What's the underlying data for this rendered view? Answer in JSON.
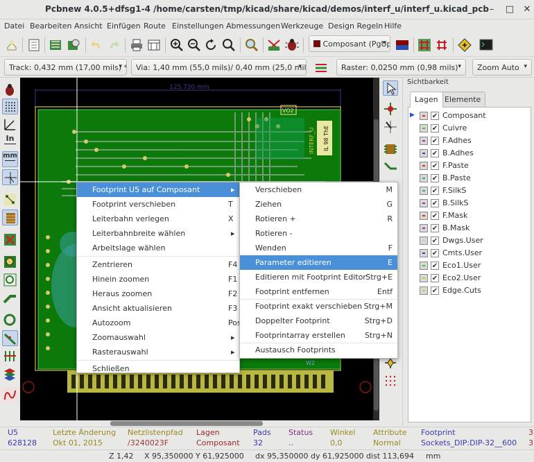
{
  "window": {
    "title": "Pcbnew 4.0.5+dfsg1-4 /home/carsten/tmp/kicad/share/kicad/demos/interf_u/interf_u.kicad_pcb"
  },
  "menubar": [
    "Datei",
    "Bearbeiten",
    "Ansicht",
    "Einfügen",
    "Route",
    "Einstellungen",
    "Abmessungen",
    "Werkzeuge",
    "Design Regeln",
    "Hilfe"
  ],
  "toolbar": {
    "layer_combo": "Composant (PgUp)"
  },
  "toolbar2": {
    "track": "Track: 0,432 mm (17,00 mils) *",
    "via": "Via: 1,40 mm (55,0 mils)/ 0,40 mm (25,0 mils) *",
    "grid": "Raster: 0,0250 mm (0,98 mils)",
    "zoom": "Zoom Auto"
  },
  "left_toolbar": {
    "inch_label": "In",
    "mm_label": "mm"
  },
  "panel": {
    "title": "Sichtbarkeit",
    "tabs": [
      "Lagen",
      "Elemente"
    ],
    "layers": [
      {
        "name": "Composant",
        "color": "#c83232",
        "active": true
      },
      {
        "name": "Cuivre",
        "color": "#32c832",
        "active": false
      },
      {
        "name": "F.Adhes",
        "color": "#a02ca0",
        "active": false
      },
      {
        "name": "B.Adhes",
        "color": "#3232c8",
        "active": false
      },
      {
        "name": "F.Paste",
        "color": "#c83232",
        "active": false
      },
      {
        "name": "B.Paste",
        "color": "#32a0a0",
        "active": false
      },
      {
        "name": "F.SilkS",
        "color": "#32a0a0",
        "active": false
      },
      {
        "name": "B.SilkS",
        "color": "#a02ca0",
        "active": false
      },
      {
        "name": "F.Mask",
        "color": "#c83232",
        "active": false
      },
      {
        "name": "B.Mask",
        "color": "#a02ca0",
        "active": false
      },
      {
        "name": "Dwgs.User",
        "color": "#c8c8c8",
        "active": false
      },
      {
        "name": "Cmts.User",
        "color": "#3232c8",
        "active": false
      },
      {
        "name": "Eco1.User",
        "color": "#32c832",
        "active": false
      },
      {
        "name": "Eco2.User",
        "color": "#c8c832",
        "active": false
      },
      {
        "name": "Edge.Cuts",
        "color": "#c8c832",
        "active": false
      }
    ]
  },
  "canvas": {
    "dim_label": "125,730 mm",
    "board_text1": "INTERF_U",
    "board_text2": "IL 98 ThE",
    "ref_vo2": "VO2",
    "ref_w2": "W2"
  },
  "context_menu": [
    {
      "label": "Footprint U5 auf Composant",
      "key": "",
      "submenu": true
    },
    {
      "label": "Footprint verschieben",
      "key": "T"
    },
    {
      "label": "Leiterbahn verlegen",
      "key": "X"
    },
    {
      "label": "Leiterbahnbreite wählen",
      "key": "",
      "submenu": true
    },
    {
      "label": "Arbeitslage wählen",
      "key": ""
    },
    {
      "label": "Zentrieren",
      "key": "F4"
    },
    {
      "label": "Hinein zoomen",
      "key": "F1"
    },
    {
      "label": "Heraus zoomen",
      "key": "F2"
    },
    {
      "label": "Ansicht aktualisieren",
      "key": "F3"
    },
    {
      "label": "Autozoom",
      "key": "Pos1"
    },
    {
      "label": "Zoomauswahl",
      "key": "",
      "submenu": true
    },
    {
      "label": "Rasterauswahl",
      "key": "",
      "submenu": true
    },
    {
      "label": "Schließen",
      "key": ""
    }
  ],
  "submenu": [
    {
      "label": "Verschieben",
      "key": "M"
    },
    {
      "label": "Ziehen",
      "key": "G"
    },
    {
      "label": "Rotieren +",
      "key": "R"
    },
    {
      "label": "Rotieren -",
      "key": ""
    },
    {
      "label": "Wenden",
      "key": "F"
    },
    {
      "label": "Parameter editieren",
      "key": "E"
    },
    {
      "label": "Editieren mit Footprint Editor",
      "key": "Strg+E"
    },
    {
      "label": "Footprint entfernen",
      "key": "Entf"
    },
    {
      "label": "Footprint exakt verschieben",
      "key": "Strg+M"
    },
    {
      "label": "Doppelter Footprint",
      "key": "Strg+D"
    },
    {
      "label": "Footprintarray erstellen",
      "key": "Strg+N"
    },
    {
      "label": "Austausch Footprints",
      "key": ""
    }
  ],
  "msgpanel": [
    {
      "head": "U5",
      "val": "628128"
    },
    {
      "head": "Letzte Änderung",
      "val": "Okt 01, 2015"
    },
    {
      "head": "Netzlistenpfad",
      "val": "/3240023F"
    },
    {
      "head": "Lagen",
      "val": "Composant"
    },
    {
      "head": "Pads",
      "val": "32"
    },
    {
      "head": "Status",
      "val": ".."
    },
    {
      "head": "Winkel",
      "val": "0,0"
    },
    {
      "head": "Attribute",
      "val": "Normal"
    },
    {
      "head": "Footprint",
      "val": "Sockets_DIP:DIP-32__600"
    },
    {
      "head": "3",
      "val": "3"
    }
  ],
  "statusbar": {
    "zoom": "Z 1,42",
    "xy": "X 95,350000  Y 61,925000",
    "dxy": "dx 95,350000  dy 61,925000  dist 113,694",
    "units": "mm"
  }
}
